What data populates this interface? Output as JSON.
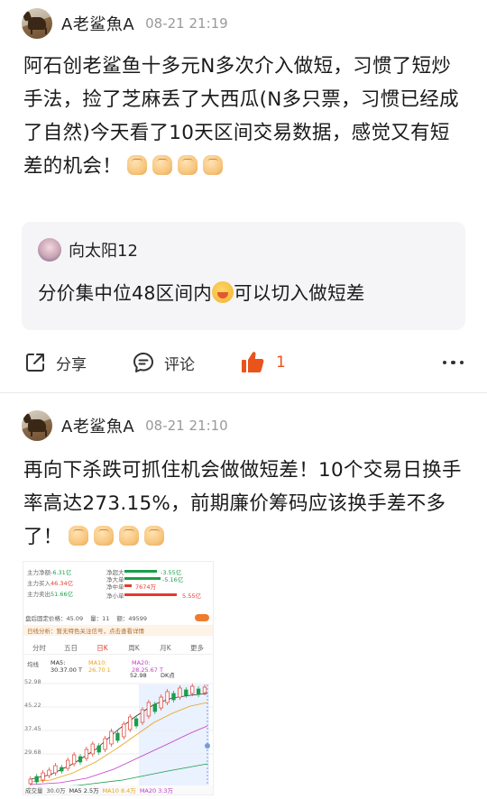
{
  "posts": [
    {
      "author": "A老鲨魚A",
      "time": "08-21 21:19",
      "text": "阿石创老鲨鱼十多元N多次介入做短，习惯了短炒手法，捡了芝麻丢了大西瓜(N多只票，习惯已经成了自然)今天看了10天区间交易数据，感觉又有短差的机会！",
      "emoji_icons": [
        "raised-fist-icon",
        "raised-fist-icon",
        "raised-fist-icon",
        "raised-fist-icon"
      ],
      "quote": {
        "author": "向太阳12",
        "text_before": "分价集中位48区间内",
        "emoji": "yum-face-icon",
        "text_after": "可以切入做短差"
      },
      "actions": {
        "share": "分享",
        "comment": "评论",
        "like_count": "1"
      }
    },
    {
      "author": "A老鲨魚A",
      "time": "08-21 21:10",
      "text": "再向下杀跌可抓住机会做做短差！10个交易日换手率高达273.15%，前期廉价筹码应该换手差不多了！",
      "emoji_icons": [
        "clap-hands-icon",
        "clap-hands-icon",
        "clap-hands-icon",
        "clap-hands-icon"
      ],
      "screenshot": {
        "flow_rows": [
          {
            "label": "主力净额",
            "value": "-6.31亿",
            "right_label": "净超大",
            "right_value": "-3.55亿"
          },
          {
            "label": "主力买入",
            "value": "46.34亿",
            "right_label": "净大单",
            "right_value": "-5.16亿"
          },
          {
            "label": "主力卖出",
            "value": "51.66亿",
            "right_label": "净中单",
            "right_value": "7674万"
          },
          {
            "label": "",
            "value": "",
            "right_label": "净小单",
            "right_value": "5.55亿"
          }
        ],
        "notice_left": "盘后固定价格：45.09",
        "notice_mid": "量：11",
        "notice_right": "额：49599",
        "hint": "日线分析：暂无特色关注信号，点击查看详情",
        "tabs": [
          "分时",
          "五日",
          "日K",
          "周K",
          "月K",
          "更多"
        ],
        "active_tab": "日K",
        "ma_labels": [
          "均线",
          "MA5:",
          "MA10:",
          "MA20:",
          "DK点"
        ],
        "ma_values": [
          "30.37.00 T",
          "26.70 1",
          "28.25.67 T"
        ],
        "y_ticks": [
          "52.98",
          "45.22",
          "37.45",
          "29.68"
        ],
        "price_high": "52.98",
        "volume_label": "成交量",
        "volume_values": [
          "30.0万",
          "MA5 2.5万",
          "MA10 8.4万",
          "MA20 3.3万"
        ],
        "colors": {
          "up": "#e23b2e",
          "down": "#1a9e4b",
          "ma5": "#333333",
          "ma10": "#e8a21c",
          "ma20": "#c23ac9"
        }
      }
    }
  ]
}
